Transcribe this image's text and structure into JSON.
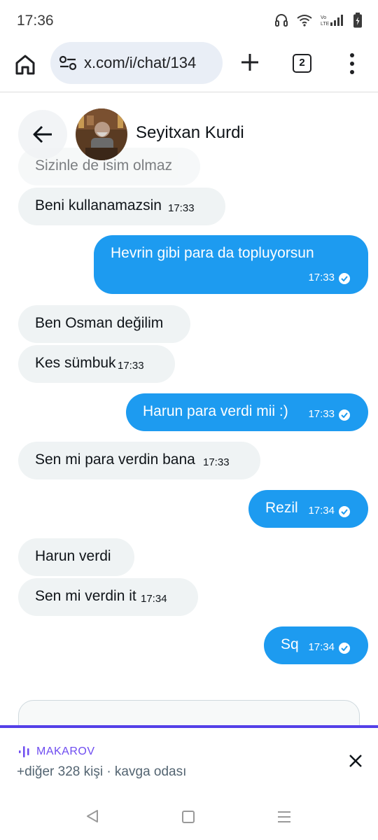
{
  "status": {
    "time": "17:36"
  },
  "browser": {
    "url": "x.com/i/chat/134",
    "tab_count": "2"
  },
  "chat": {
    "contact_name": "Seyitxan Kurdi",
    "messages": [
      {
        "direction": "in",
        "text": "Sizinle de isim olmaz",
        "time": ""
      },
      {
        "direction": "in",
        "text": "Beni kullanamazsin",
        "time": "17:33"
      },
      {
        "direction": "out",
        "text": "Hevrin gibi para da topluyorsun",
        "time": "17:33"
      },
      {
        "direction": "in",
        "text": "Ben Osman değilim",
        "time": ""
      },
      {
        "direction": "in",
        "text": "Kes sümbuk",
        "time": "17:33"
      },
      {
        "direction": "out",
        "text": "Harun para verdi mii :)",
        "time": "17:33"
      },
      {
        "direction": "in",
        "text": "Sen mi para verdin bana",
        "time": "17:33"
      },
      {
        "direction": "out",
        "text": "Rezil",
        "time": "17:34"
      },
      {
        "direction": "in",
        "text": "Harun verdi",
        "time": ""
      },
      {
        "direction": "in",
        "text": "Sen mi verdin it",
        "time": "17:34"
      },
      {
        "direction": "out",
        "text": "Sq",
        "time": "17:34"
      }
    ]
  },
  "space": {
    "host": "MAKAROV",
    "subtitle": "+diğer 328 kişi · kavga odası"
  },
  "colors": {
    "outgoing_bubble": "#1d9bf0",
    "incoming_bubble": "#eff3f4",
    "space_accent": "#5440e8"
  },
  "icons": {
    "home": "home-icon",
    "site_settings": "tune-icon",
    "new_tab": "plus-icon",
    "menu": "more-vert-icon",
    "back": "arrow-left-icon",
    "read": "check-circle-icon",
    "close": "close-icon"
  }
}
